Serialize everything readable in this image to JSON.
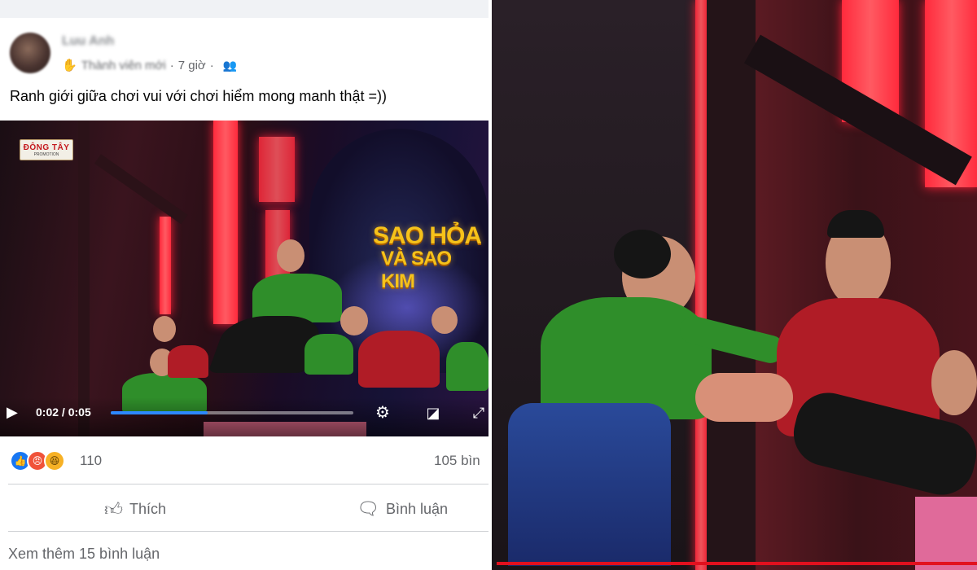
{
  "post": {
    "author": "Luu Anh",
    "badge": "Thành viên mới",
    "time": "7 giờ",
    "text": "Ranh giới giữa chơi vui với chơi hiểm mong manh thật =))"
  },
  "video": {
    "channel_logo": "ĐÔNG TÂY",
    "channel_logo_sub": "PROMOTION",
    "show_title_line1": "SAO HỎA",
    "show_title_line2": "VÀ SAO KIM",
    "current_time": "0:02",
    "duration": "0:05",
    "time_separator": "/",
    "progress": 0.4
  },
  "stats": {
    "reactions": [
      "like",
      "angry",
      "haha"
    ],
    "reaction_count": "110",
    "comment_count": "105 bìn"
  },
  "actions": {
    "like_label": "Thích",
    "comment_label": "Bình luận"
  },
  "more_comments": "Xem thêm 15 bình luận",
  "colors": {
    "accent": "#1877f2",
    "progress": "#2d88ff",
    "stage_red": "#ff2a3c",
    "jersey_green": "#2f8e2a",
    "jersey_red": "#b01c26"
  }
}
